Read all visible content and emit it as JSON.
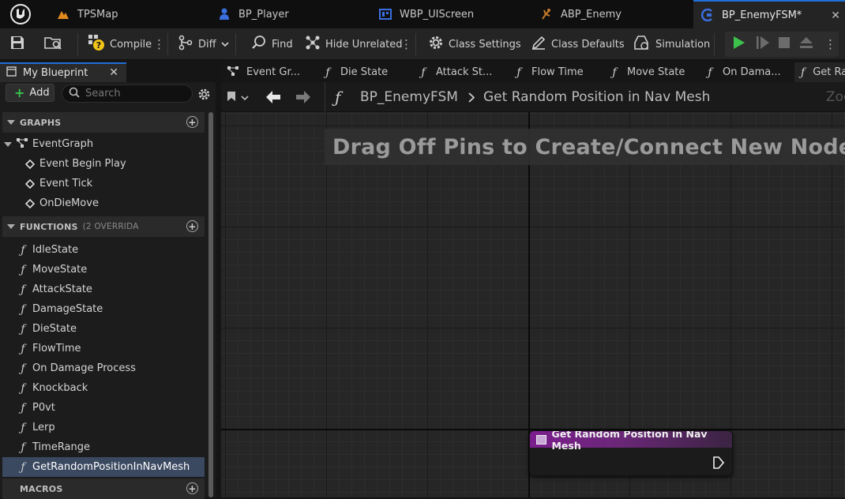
{
  "doc_tabs": [
    {
      "label": "TPSMap",
      "icon": "level-map-icon"
    },
    {
      "label": "BP_Player",
      "icon": "character-blueprint-icon"
    },
    {
      "label": "WBP_UIScreen",
      "icon": "widget-blueprint-icon"
    },
    {
      "label": "ABP_Enemy",
      "icon": "anim-blueprint-icon"
    },
    {
      "label": "BP_EnemyFSM*",
      "icon": "blueprint-class-icon",
      "active": true
    }
  ],
  "toolbar": {
    "compile": "Compile",
    "diff": "Diff",
    "find": "Find",
    "hide_unrelated": "Hide Unrelated",
    "class_settings": "Class Settings",
    "class_defaults": "Class Defaults",
    "simulation": "Simulation"
  },
  "left_panel": {
    "tab_title": "My Blueprint",
    "add_label": "Add",
    "search_placeholder": "Search",
    "graphs_header": "GRAPHS",
    "graphs": [
      {
        "label": "EventGraph",
        "kind": "graph"
      },
      {
        "label": "Event Begin Play",
        "kind": "event"
      },
      {
        "label": "Event Tick",
        "kind": "event"
      },
      {
        "label": "OnDieMove",
        "kind": "event"
      }
    ],
    "functions_header": "FUNCTIONS",
    "functions_sub": "(2 OVERRIDA",
    "functions": [
      "IdleState",
      "MoveState",
      "AttackState",
      "DamageState",
      "DieState",
      "FlowTime",
      "On Damage Process",
      "Knockback",
      "P0vt",
      "Lerp",
      "TimeRange",
      "GetRandomPositionInNavMesh"
    ],
    "selected_function": "GetRandomPositionInNavMesh",
    "macros_header": "MACROS"
  },
  "graph_tabs": [
    "Event Gr...",
    "Die State",
    "Attack St...",
    "Flow Time",
    "Move State",
    "On Dama...",
    "Get Ra"
  ],
  "graph_nav": {
    "breadcrumb_root": "BP_EnemyFSM",
    "breadcrumb_leaf": "Get Random Position in Nav Mesh",
    "zoom_label": "Zoo"
  },
  "graph": {
    "hint": "Drag Off Pins to Create/Connect New Nodes.",
    "node_title": "Get Random Position in Nav Mesh"
  },
  "colors": {
    "accent_blue": "#1f6fd6",
    "play_green": "#3cc24a",
    "function_node_header": "#7b1e8e",
    "selection": "#3a4860"
  }
}
